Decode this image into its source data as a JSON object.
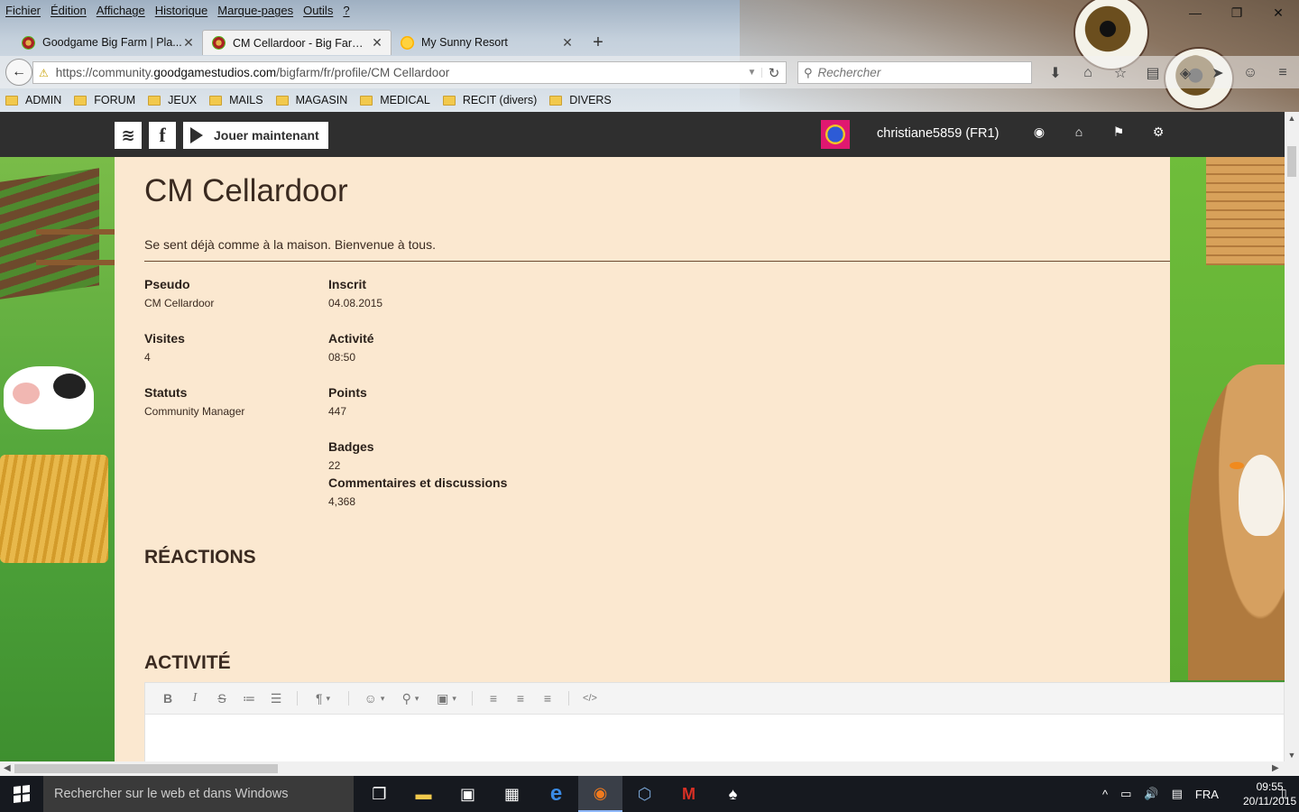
{
  "menubar": {
    "items": [
      "Fichier",
      "Édition",
      "Affichage",
      "Historique",
      "Marque-pages",
      "Outils",
      "?"
    ]
  },
  "window_controls": {
    "minimize": "—",
    "restore": "❐",
    "close": "✕"
  },
  "tabs": [
    {
      "title": "Goodgame Big Farm | Pla...",
      "close": "✕"
    },
    {
      "title": "CM Cellardoor - Big Farm ...",
      "close": "✕"
    },
    {
      "title": "My Sunny Resort",
      "close": "✕"
    },
    {
      "new_tab": "+"
    }
  ],
  "navbar": {
    "back": "←",
    "url_prefix": "https://community.",
    "url_domain": "goodgamestudios.com",
    "url_path": "/bigfarm/fr/profile/CM Cellardoor",
    "search_placeholder": "Rechercher",
    "tools": [
      "⬇",
      "⌂",
      "☆",
      "▤",
      "◈",
      "➤",
      "☺",
      "≡"
    ]
  },
  "bookmarks": [
    "ADMIN",
    "FORUM",
    "JEUX",
    "MAILS",
    "MAGASIN",
    "MEDICAL",
    "RECIT (divers)",
    "DIVERS"
  ],
  "site_header": {
    "ggs_logo": "≋",
    "fb_logo": "f",
    "play_label": "Jouer maintenant",
    "username": "christiane5859 (FR1)",
    "icons": [
      "◉",
      "⌂",
      "⚑",
      "⚙"
    ]
  },
  "profile": {
    "name": "CM Cellardoor",
    "tagline": "Se sent déjà comme à la maison. Bienvenue à tous.",
    "fields": {
      "pseudo": {
        "label": "Pseudo",
        "value": "CM Cellardoor"
      },
      "inscrit": {
        "label": "Inscrit",
        "value": "04.08.2015"
      },
      "visites": {
        "label": "Visites",
        "value": "4"
      },
      "activite": {
        "label": "Activité",
        "value": "08:50"
      },
      "statuts": {
        "label": "Statuts",
        "value": "Community Manager"
      },
      "points": {
        "label": "Points",
        "value": "447"
      },
      "badges": {
        "label": "Badges",
        "value": "22"
      },
      "commentaires": {
        "label": "Commentaires et discussions",
        "value": "4,368"
      }
    },
    "sections": {
      "reactions": "RÉACTIONS",
      "activite": "ACTIVITÉ"
    }
  },
  "editor": {
    "tools": [
      "B",
      "I",
      "S",
      "≔",
      "☰",
      "¶",
      "☺",
      "⚲",
      "▣",
      "≡",
      "≡",
      "≡",
      "</>"
    ]
  },
  "scroll": {
    "up": "▲",
    "down": "▼",
    "left": "◀",
    "right": "▶"
  },
  "taskbar": {
    "search_placeholder": "Rechercher sur le web et dans Windows",
    "apps": [
      "❐",
      "▬",
      "▣",
      "▦",
      "e",
      "◉",
      "⬡",
      "M",
      "♠"
    ],
    "tray": [
      "^",
      "▭",
      "🔊",
      "▤",
      "FRA"
    ],
    "time": "09:55",
    "date": "20/11/2015",
    "notification_icon": "▯"
  }
}
